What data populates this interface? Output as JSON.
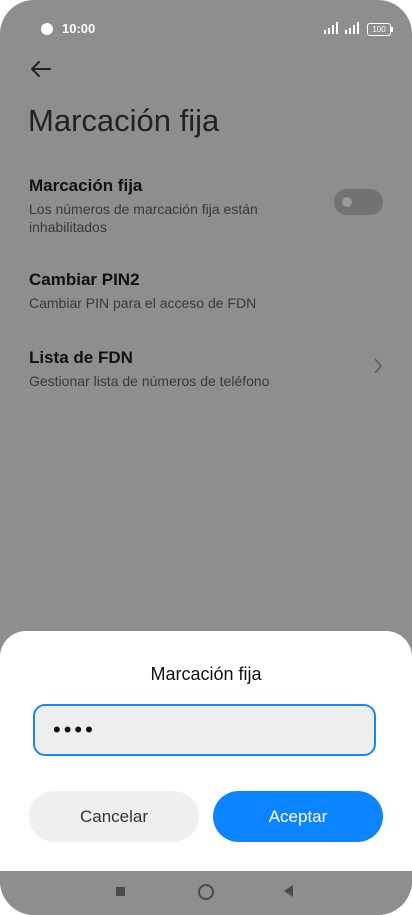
{
  "status_bar": {
    "time": "10:00",
    "battery": "100"
  },
  "header": {
    "title": "Marcación fija"
  },
  "settings": [
    {
      "title": "Marcación fija",
      "subtitle": "Los números de marcación fija están inhabilitados"
    },
    {
      "title": "Cambiar PIN2",
      "subtitle": "Cambiar PIN para el acceso de FDN"
    },
    {
      "title": "Lista de FDN",
      "subtitle": "Gestionar lista de números de teléfono"
    }
  ],
  "dialog": {
    "title": "Marcación fija",
    "pin_value": "••••",
    "cancel_label": "Cancelar",
    "ok_label": "Aceptar"
  },
  "colors": {
    "accent": "#0d84ff",
    "overlay": "#8e8e8e"
  }
}
